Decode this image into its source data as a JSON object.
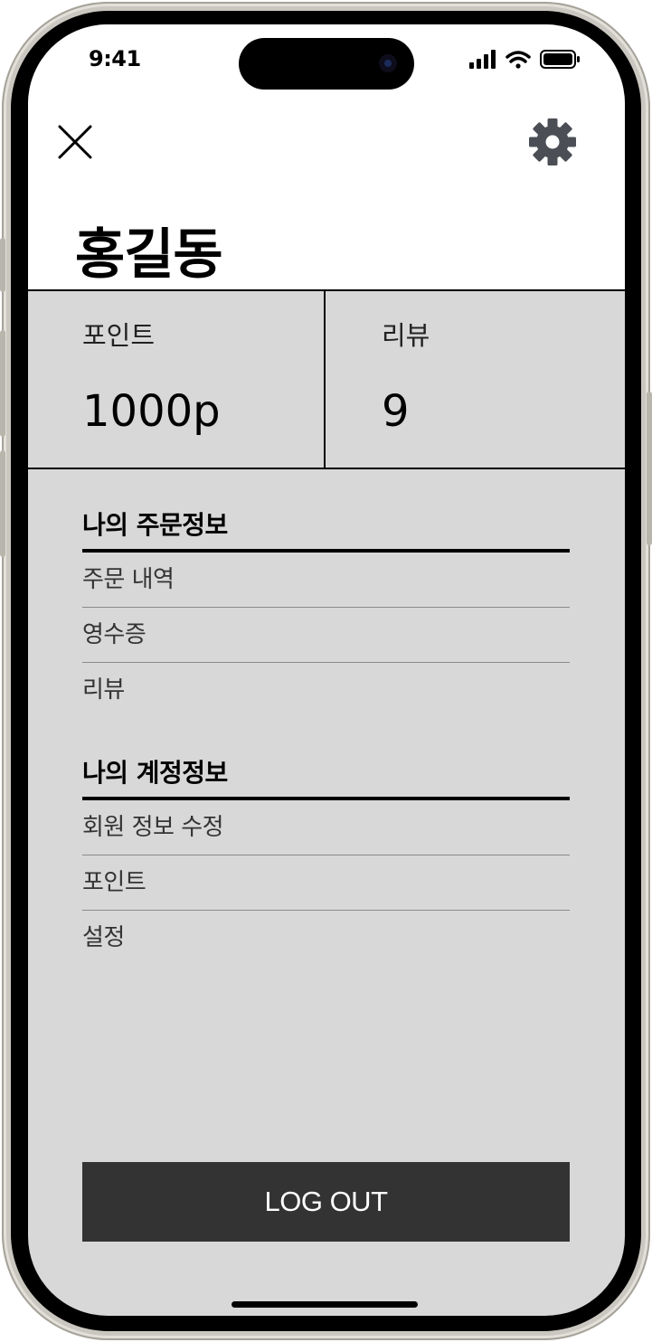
{
  "status_bar": {
    "time": "9:41",
    "icons": [
      "cellular-signal-icon",
      "wifi-icon",
      "battery-icon"
    ]
  },
  "header": {
    "close_icon": "close-icon",
    "settings_icon": "gear-icon",
    "user_name": "홍길동"
  },
  "stats": [
    {
      "label": "포인트",
      "value": "1000p"
    },
    {
      "label": "리뷰",
      "value": "9"
    }
  ],
  "sections": [
    {
      "title": "나의 주문정보",
      "items": [
        {
          "label": "주문 내역"
        },
        {
          "label": "영수증"
        },
        {
          "label": "리뷰"
        }
      ]
    },
    {
      "title": "나의 계정정보",
      "items": [
        {
          "label": "회원 정보 수정"
        },
        {
          "label": "포인트"
        },
        {
          "label": "설정"
        }
      ]
    }
  ],
  "logout_label": "LOG OUT",
  "colors": {
    "background": "#d8d8d8",
    "header_background": "#ffffff",
    "button": "#333333",
    "gear_icon": "#4b4e55"
  }
}
